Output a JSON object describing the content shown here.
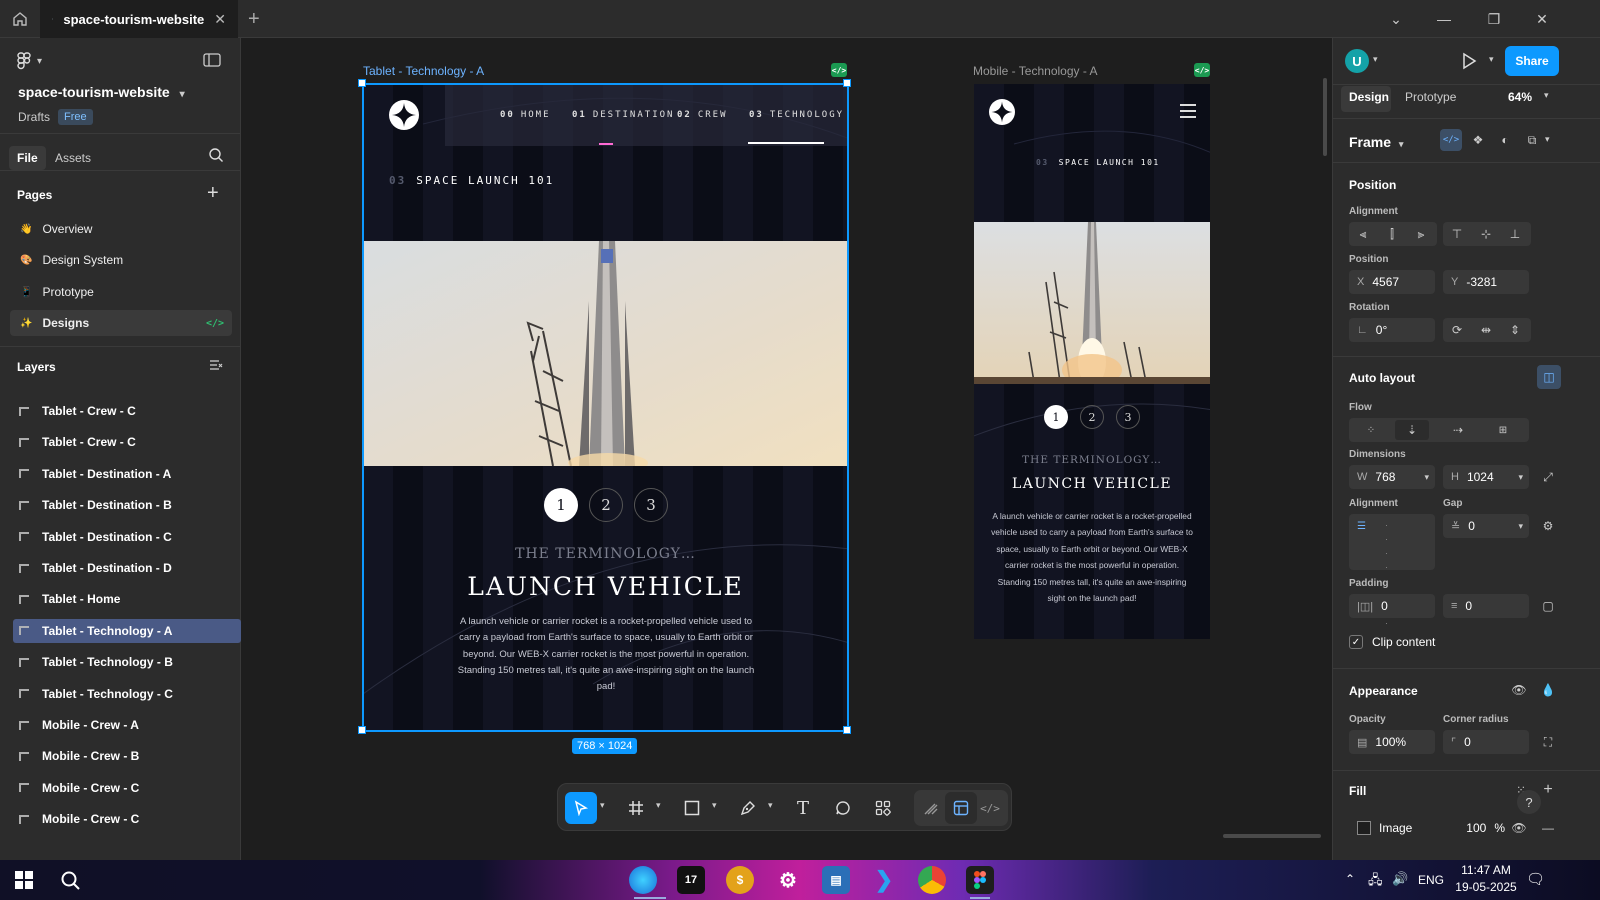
{
  "titlebar": {
    "tab_title": "space-tourism-website"
  },
  "left_panel": {
    "project_name": "space-tourism-website",
    "drafts_label": "Drafts",
    "plan_badge": "Free",
    "file_tab": "File",
    "assets_tab": "Assets",
    "pages_heading": "Pages",
    "pages": [
      {
        "label": "Overview",
        "emoji": "👋"
      },
      {
        "label": "Design System",
        "emoji": "🎨"
      },
      {
        "label": "Prototype",
        "emoji": "📱"
      },
      {
        "label": "Designs",
        "emoji": "✨"
      }
    ],
    "layers_heading": "Layers",
    "layers": [
      "Tablet - Crew - C",
      "Tablet - Crew - C",
      "Tablet - Destination - A",
      "Tablet - Destination - B",
      "Tablet - Destination - C",
      "Tablet - Destination - D",
      "Tablet - Home",
      "Tablet - Technology - A",
      "Tablet - Technology - B",
      "Tablet - Technology - C",
      "Mobile - Crew - A",
      "Mobile - Crew - B",
      "Mobile - Crew - C",
      "Mobile - Crew - C"
    ]
  },
  "canvas": {
    "tablet": {
      "label": "Tablet - Technology - A",
      "size_badge": "768 × 1024",
      "nav": [
        {
          "num": "00",
          "text": "HOME"
        },
        {
          "num": "01",
          "text": "DESTINATION"
        },
        {
          "num": "02",
          "text": "CREW"
        },
        {
          "num": "03",
          "text": "TECHNOLOGY"
        }
      ],
      "section_num": "03",
      "section_title": "SPACE LAUNCH 101",
      "pills": [
        "1",
        "2",
        "3"
      ],
      "terminology": "THE TERMINOLOGY…",
      "vehicle": "LAUNCH VEHICLE",
      "description": "A launch vehicle or carrier rocket is a rocket-propelled vehicle used to carry a payload from Earth's surface to space, usually to Earth orbit or beyond. Our WEB-X carrier rocket is the most powerful in operation. Standing 150 metres tall, it's quite an awe-inspiring sight on the launch pad!"
    },
    "mobile": {
      "label": "Mobile - Technology - A",
      "section_num": "03",
      "section_title": "SPACE LAUNCH 101",
      "pills": [
        "1",
        "2",
        "3"
      ],
      "terminology": "THE TERMINOLOGY…",
      "vehicle": "LAUNCH VEHICLE",
      "description": "A launch vehicle or carrier rocket is a rocket-propelled vehicle used to carry a payload from Earth's surface to space, usually to Earth orbit or beyond. Our WEB-X carrier rocket is the most powerful in operation. Standing 150 metres tall, it's quite an awe-inspiring sight on the launch pad!"
    }
  },
  "right_panel": {
    "avatar_letter": "U",
    "share_label": "Share",
    "design_tab": "Design",
    "prototype_tab": "Prototype",
    "zoom": "64%",
    "frame_label": "Frame",
    "position_heading": "Position",
    "alignment_label": "Alignment",
    "position_label": "Position",
    "x_key": "X",
    "x_value": "4567",
    "y_key": "Y",
    "y_value": "-3281",
    "rotation_label": "Rotation",
    "rotation_value": "0°",
    "auto_layout_heading": "Auto layout",
    "flow_label": "Flow",
    "dimensions_label": "Dimensions",
    "w_key": "W",
    "w_value": "768",
    "h_key": "H",
    "h_value": "1024",
    "alignment_label2": "Alignment",
    "gap_label": "Gap",
    "gap_value": "0",
    "padding_label": "Padding",
    "padding_h": "0",
    "padding_v": "0",
    "clip_content": "Clip content",
    "appearance_heading": "Appearance",
    "opacity_label": "Opacity",
    "opacity_value": "100%",
    "corner_label": "Corner radius",
    "corner_value": "0",
    "fill_heading": "Fill",
    "fill_type": "Image",
    "fill_opacity": "100",
    "fill_pct": "%",
    "help": "?"
  },
  "taskbar": {
    "language": "ENG",
    "time": "11:47 AM",
    "date": "19-05-2025"
  },
  "colors": {
    "accent": "#0d99ff",
    "share": "#0d99ff",
    "selection": "#4a5a86",
    "dev_mode": "#1b9a52"
  }
}
